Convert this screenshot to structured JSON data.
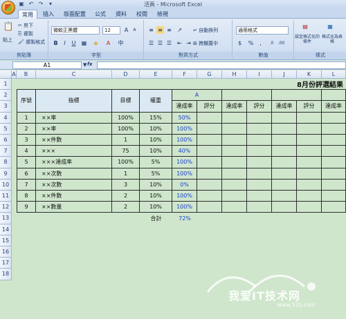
{
  "window": {
    "title": "活頁 - Microsoft Excel"
  },
  "tabs": [
    "常用",
    "插入",
    "版面配置",
    "公式",
    "資料",
    "校閱",
    "檢視"
  ],
  "ribbon": {
    "clipboard": {
      "paste": "貼上",
      "cut": "剪下",
      "copy": "複製",
      "format_painter": "複製格式",
      "label": "剪貼簿"
    },
    "font": {
      "name": "微軟正黑體",
      "size": "12",
      "label": "字型",
      "bold": "B",
      "italic": "I",
      "underline": "U"
    },
    "alignment": {
      "wrap": "自動換列",
      "merge": "跨欄置中",
      "label": "對齊方式"
    },
    "number": {
      "format": "通用格式",
      "currency": "$",
      "percent": "%",
      "comma": ",",
      "label": "數值"
    },
    "styles": {
      "conditional": "設定格式化的條件",
      "table": "格式化為表格",
      "label": "樣式"
    }
  },
  "formula_bar": {
    "name_box": "A1",
    "fx": "fx"
  },
  "columns": [
    "A",
    "B",
    "C",
    "D",
    "E",
    "F",
    "G",
    "H",
    "I",
    "J",
    "K",
    "L"
  ],
  "rows": [
    "1",
    "2",
    "3",
    "4",
    "5",
    "6",
    "7",
    "8",
    "9",
    "10",
    "11",
    "12",
    "13",
    "14",
    "15",
    "16",
    "17",
    "18"
  ],
  "sheet": {
    "title": "8月份評選結果",
    "headers": {
      "seq": "序號",
      "indicator": "指標",
      "target": "目標",
      "weight": "權重",
      "a_label": "A",
      "rate": "達成率",
      "score": "評分"
    },
    "data": [
      {
        "seq": "1",
        "indicator": "××率",
        "target": "100%",
        "weight": "15%",
        "rate": "50%"
      },
      {
        "seq": "2",
        "indicator": "××率",
        "target": "100%",
        "weight": "10%",
        "rate": "100%"
      },
      {
        "seq": "3",
        "indicator": "××件數",
        "target": "1",
        "weight": "10%",
        "rate": "100%"
      },
      {
        "seq": "4",
        "indicator": "×××",
        "target": "75",
        "weight": "10%",
        "rate": "40%"
      },
      {
        "seq": "5",
        "indicator": "×××達成率",
        "target": "100%",
        "weight": "5%",
        "rate": "100%"
      },
      {
        "seq": "6",
        "indicator": "××次數",
        "target": "1",
        "weight": "5%",
        "rate": "100%"
      },
      {
        "seq": "7",
        "indicator": "××次數",
        "target": "3",
        "weight": "10%",
        "rate": "0%"
      },
      {
        "seq": "8",
        "indicator": "××件數",
        "target": "2",
        "weight": "10%",
        "rate": "100%"
      },
      {
        "seq": "9",
        "indicator": "××數量",
        "target": "2",
        "weight": "10%",
        "rate": "100%"
      }
    ],
    "total_label": "合計",
    "total_value": "72%"
  },
  "watermark": {
    "text": "我爱IT技术网",
    "url": "www.52ij.com"
  }
}
